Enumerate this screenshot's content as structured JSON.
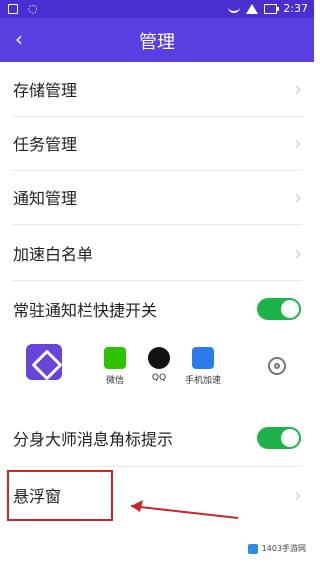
{
  "status_bar": {
    "time": "2:37"
  },
  "app_bar": {
    "back_glyph": "‹",
    "title": "管理"
  },
  "rows": [
    {
      "label": "存储管理",
      "kind": "chevron"
    },
    {
      "label": "任务管理",
      "kind": "chevron"
    },
    {
      "label": "通知管理",
      "kind": "chevron"
    },
    {
      "label": "加速白名单",
      "kind": "chevron"
    },
    {
      "label": "常驻通知栏快捷开关",
      "kind": "toggle",
      "on": true
    },
    {
      "label": "分身大师消息角标提示",
      "kind": "toggle",
      "on": true
    },
    {
      "label": "悬浮窗",
      "kind": "chevron",
      "highlighted": true
    }
  ],
  "quick_bar": {
    "apps": [
      {
        "name": "微信",
        "icon": "wechat-icon",
        "color": "#2dc100"
      },
      {
        "name": "QQ",
        "icon": "qq-penguin-icon",
        "color": "#111111"
      },
      {
        "name": "手机加速",
        "icon": "rocket-icon",
        "color": "#2d7be8"
      }
    ]
  },
  "watermark": {
    "text": "1403手游网"
  },
  "colors": {
    "status_bar": "#4a2fd0",
    "app_bar": "#5a3fe0",
    "toggle_on": "#1db34a",
    "highlight": "#c62828"
  }
}
